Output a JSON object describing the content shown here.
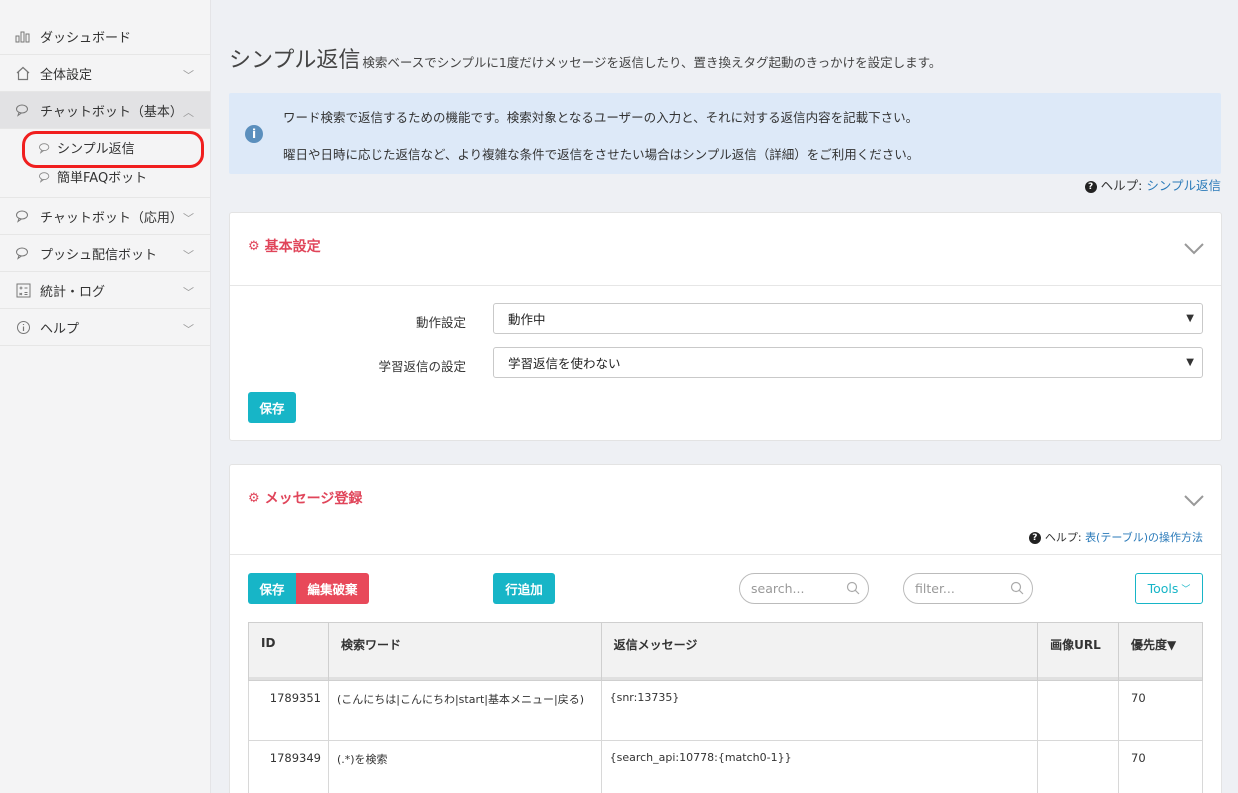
{
  "sidebar": {
    "items": [
      {
        "label": "ダッシュボード",
        "icon": "bar-chart-icon"
      },
      {
        "label": "全体設定",
        "icon": "home-icon"
      },
      {
        "label": "チャットボット（基本）",
        "icon": "chat-icon"
      },
      {
        "label": "チャットボット（応用）",
        "icon": "chat-icon"
      },
      {
        "label": "プッシュ配信ボット",
        "icon": "chat-icon"
      },
      {
        "label": "統計・ログ",
        "icon": "calculator-icon"
      },
      {
        "label": "ヘルプ",
        "icon": "info-circle-icon"
      }
    ],
    "sub_items": [
      {
        "label": "シンプル返信"
      },
      {
        "label": "簡単FAQボット"
      }
    ]
  },
  "page": {
    "title": "シンプル返信",
    "subtitle": "検索ベースでシンプルに1度だけメッセージを返信したり、置き換えタグ起動のきっかけを設定します。"
  },
  "info": {
    "line1": "ワード検索で返信するための機能です。検索対象となるユーザーの入力と、それに対する返信内容を記載下さい。",
    "line2": "曜日や日時に応じた返信など、より複雑な条件で返信をさせたい場合はシンプル返信（詳細）をご利用ください。"
  },
  "help_top": {
    "prefix": "ヘルプ:",
    "link": "シンプル返信"
  },
  "basic": {
    "title": "基本設定",
    "rows": [
      {
        "label": "動作設定",
        "value": "動作中"
      },
      {
        "label": "学習返信の設定",
        "value": "学習返信を使わない"
      }
    ],
    "save": "保存"
  },
  "messages": {
    "title": "メッセージ登録",
    "help_prefix": "ヘルプ:",
    "help_link": "表(テーブル)の操作方法",
    "save": "保存",
    "discard": "編集破棄",
    "add_row": "行追加",
    "search_placeholder": "search...",
    "filter_placeholder": "filter...",
    "tools": "Tools",
    "columns": [
      "ID",
      "検索ワード",
      "返信メッセージ",
      "画像URL",
      "優先度▼"
    ],
    "rows": [
      {
        "id": "1789351",
        "keyword": "(こんにちは|こんにちわ|start|基本メニュー|戻る)",
        "reply": "{snr:13735}",
        "image": "",
        "priority": "70"
      },
      {
        "id": "1789349",
        "keyword": "(.*)を検索",
        "reply": "{search_api:10778:{match0-1}}",
        "image": "",
        "priority": "70"
      }
    ]
  }
}
